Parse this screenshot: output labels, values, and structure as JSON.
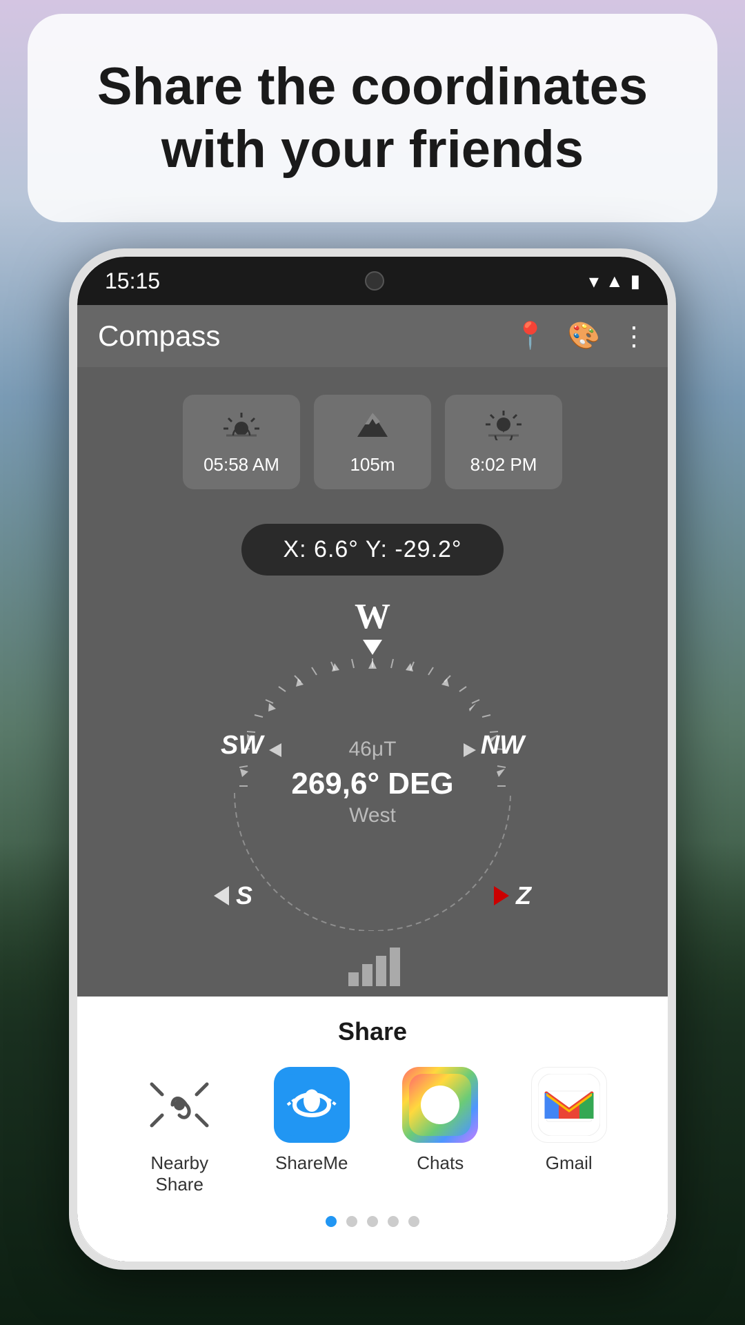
{
  "background": {
    "gradient_description": "mountain landscape at dusk with purple sky and dark forest"
  },
  "top_card": {
    "title": "Share the coordinates with your friends"
  },
  "status_bar": {
    "time": "15:15",
    "wifi_icon": "▼",
    "signal_icon": "▲",
    "battery_icon": "▮"
  },
  "app_bar": {
    "title": "Compass",
    "location_icon": "📍",
    "palette_icon": "🎨",
    "more_icon": "⋮"
  },
  "info_cards": [
    {
      "icon": "☀",
      "value": "05:58 AM",
      "label": "sunrise"
    },
    {
      "icon": "▲",
      "value": "105m",
      "label": "altitude"
    },
    {
      "icon": "☀",
      "value": "8:02 PM",
      "label": "sunset"
    }
  ],
  "coordinates": {
    "x": "X: 6.6°",
    "y": "Y: -29.2°",
    "display": "X: 6.6°     Y: -29.2°"
  },
  "compass": {
    "microtesla": "46μT",
    "degrees": "269,6° DEG",
    "direction": "West",
    "cardinal_W": "W",
    "cardinal_SW": "SW",
    "cardinal_NW": "NW",
    "cardinal_S": "S",
    "cardinal_Z": "Z"
  },
  "share_sheet": {
    "title": "Share",
    "apps": [
      {
        "id": "nearby",
        "label": "Nearby Share",
        "icon_type": "nearby"
      },
      {
        "id": "shareme",
        "label": "ShareMe",
        "icon_type": "shareme"
      },
      {
        "id": "chats",
        "label": "Chats",
        "icon_type": "chats"
      },
      {
        "id": "gmail",
        "label": "Gmail",
        "icon_type": "gmail"
      }
    ],
    "pagination_dots": [
      true,
      false,
      false,
      false,
      false
    ]
  }
}
